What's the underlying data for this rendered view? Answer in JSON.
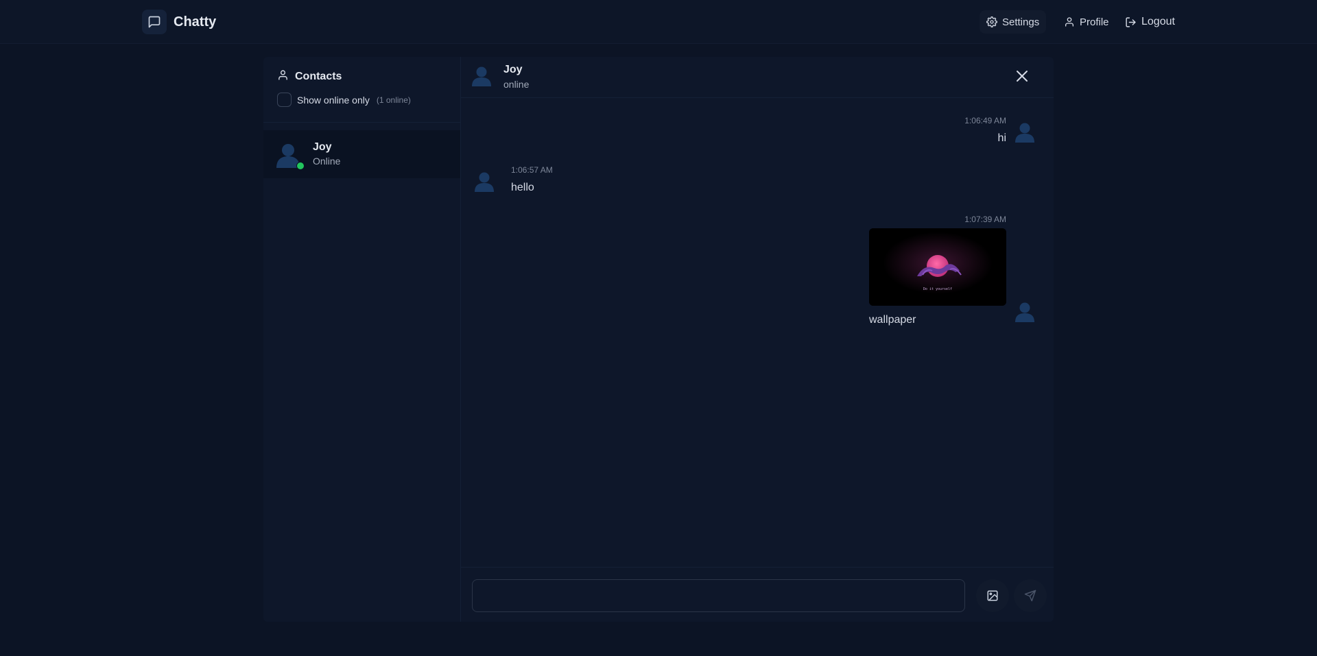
{
  "app": {
    "name": "Chatty"
  },
  "nav": {
    "settings_label": "Settings",
    "profile_label": "Profile",
    "logout_label": "Logout"
  },
  "sidebar": {
    "title": "Contacts",
    "filter_label": "Show online only",
    "online_count": "(1 online)",
    "contacts": [
      {
        "name": "Joy",
        "status": "Online"
      }
    ]
  },
  "chat": {
    "contact_name": "Joy",
    "contact_status": "online",
    "messages": [
      {
        "side": "right",
        "time": "1:06:49 AM",
        "text": "hi"
      },
      {
        "side": "left",
        "time": "1:06:57 AM",
        "text": "hello"
      },
      {
        "side": "right",
        "time": "1:07:39 AM",
        "text": "wallpaper",
        "image_caption": "Do it yourself"
      }
    ]
  },
  "composer": {
    "placeholder": "",
    "value": ""
  },
  "colors": {
    "background": "#0c1425",
    "panel": "#0e172a",
    "online": "#22c55e",
    "avatar": "#1b3a63"
  },
  "icons": [
    "message-square-icon",
    "gear-icon",
    "user-icon",
    "logout-icon",
    "close-icon",
    "image-icon",
    "send-icon"
  ]
}
